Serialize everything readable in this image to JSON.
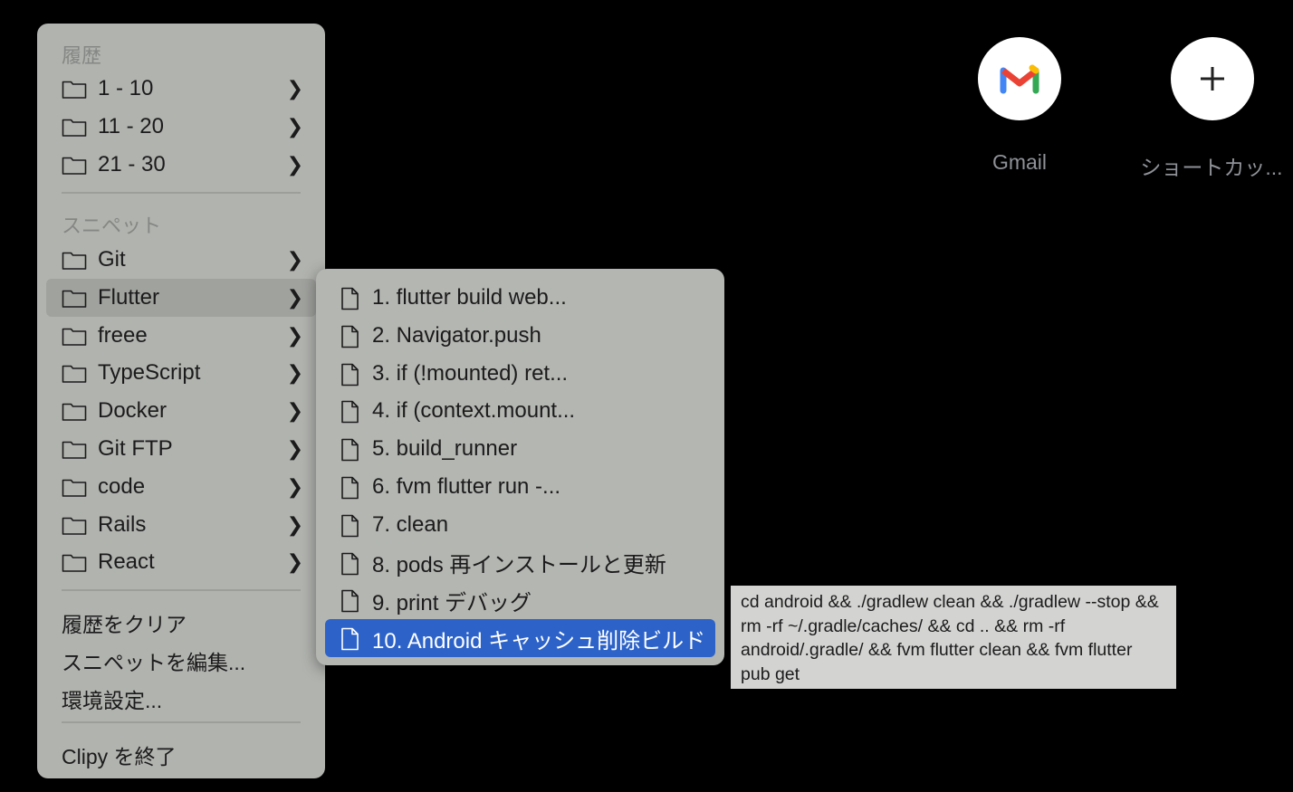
{
  "main_menu": {
    "history_heading": "履歴",
    "history": [
      {
        "label": "1 - 10"
      },
      {
        "label": "11 - 20"
      },
      {
        "label": "21 - 30"
      }
    ],
    "snippets_heading": "スニペット",
    "snippets": [
      {
        "label": "Git"
      },
      {
        "label": "Flutter"
      },
      {
        "label": "freee"
      },
      {
        "label": "TypeScript"
      },
      {
        "label": "Docker"
      },
      {
        "label": "Git FTP"
      },
      {
        "label": "code"
      },
      {
        "label": "Rails"
      },
      {
        "label": "React"
      }
    ],
    "clear_history": "履歴をクリア",
    "edit_snippets": "スニペットを編集...",
    "preferences": "環境設定...",
    "quit": "Clipy を終了"
  },
  "submenu": {
    "items": [
      {
        "label": "1. flutter build web..."
      },
      {
        "label": "2. Navigator.push"
      },
      {
        "label": "3. if (!mounted) ret..."
      },
      {
        "label": "4. if (context.mount..."
      },
      {
        "label": "5. build_runner"
      },
      {
        "label": "6. fvm flutter run -..."
      },
      {
        "label": "7. clean"
      },
      {
        "label": "8. pods 再インストールと更新"
      },
      {
        "label": "9. print デバッグ"
      },
      {
        "label": "10. Android キャッシュ削除ビルド"
      }
    ],
    "highlighted_index": 9,
    "highlight_color": "#2d63c8"
  },
  "tooltip": {
    "text": "cd android && ./gradlew clean && ./gradlew --stop && rm -rf ~/.gradle/caches/ && cd .. && rm -rf android/.gradle/ && fvm flutter clean && fvm flutter pub get"
  },
  "shortcuts": [
    {
      "label": "Gmail",
      "icon": "gmail-icon"
    },
    {
      "label": "ショートカッ...",
      "icon": "plus-icon"
    }
  ]
}
